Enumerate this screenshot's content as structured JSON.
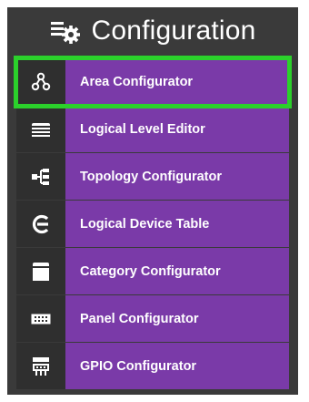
{
  "header": {
    "title": "Configuration",
    "icon": "gear-config-icon"
  },
  "colors": {
    "panel_bg": "#3a3a3a",
    "item_bg": "#7a3aa8",
    "icon_box_bg": "#2f2f2f",
    "highlight": "#2bd12b",
    "text": "#ffffff"
  },
  "menu": {
    "items": [
      {
        "label": "Area Configurator",
        "icon": "area-network-icon",
        "selected": true
      },
      {
        "label": "Logical Level Editor",
        "icon": "stacked-lines-icon",
        "selected": false
      },
      {
        "label": "Topology Configurator",
        "icon": "topology-icon",
        "selected": false
      },
      {
        "label": "Logical Device Table",
        "icon": "device-table-icon",
        "selected": false
      },
      {
        "label": "Category Configurator",
        "icon": "category-stack-icon",
        "selected": false
      },
      {
        "label": "Panel Configurator",
        "icon": "panel-keypad-icon",
        "selected": false
      },
      {
        "label": "GPIO Configurator",
        "icon": "gpio-icon",
        "selected": false
      }
    ]
  }
}
